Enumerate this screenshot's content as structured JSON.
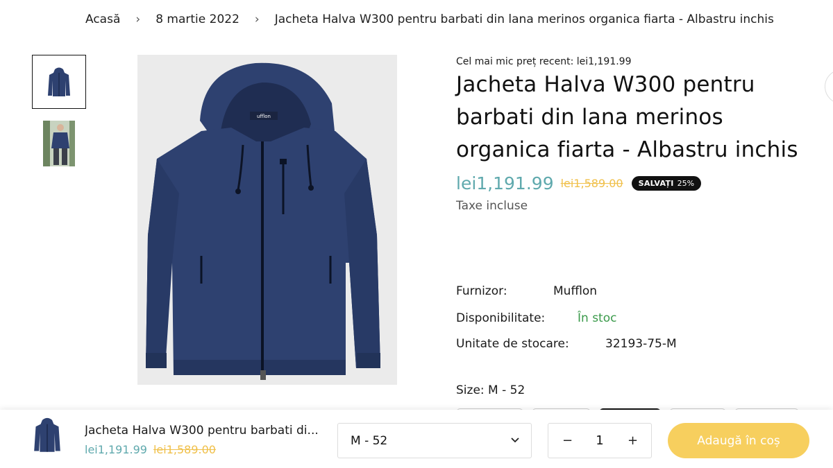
{
  "breadcrumb": {
    "items": [
      "Acasă",
      "8 martie 2022",
      "Jacheta Halva W300 pentru barbati din lana merinos organica fiarta - Albastru inchis"
    ],
    "separator": "›"
  },
  "product": {
    "lowest_price_label": "Cel mai mic preț recent: lei1,191.99",
    "title": "Jacheta Halva W300 pentru barbati din lana merinos organica fiarta - Albastru inchis",
    "price": "lei1,191.99",
    "compare_price": "lei1,589.00",
    "badge_label": "SALVAȚI",
    "badge_value": "25%",
    "tax_note": "Taxe incluse",
    "vendor_label": "Furnizor:",
    "vendor_value": "Mufflon",
    "availability_label": "Disponibilitate:",
    "availability_value": "În stoc",
    "sku_label": "Unitate de stocare:",
    "sku_value": "32193-75-M",
    "size_label": "Size: M - 52",
    "jacket_brand": "ufflon"
  },
  "sticky": {
    "title": "Jacheta Halva W300 pentru barbati di...",
    "price": "lei1,191.99",
    "compare_price": "lei1,589.00",
    "selected_variant": "M - 52",
    "quantity": "1",
    "minus": "−",
    "plus": "+",
    "add_to_cart": "Adaugă în coș"
  },
  "colors": {
    "price": "#5fa9ad",
    "compare": "#f0c04a",
    "stock": "#3a9a4a",
    "cta": "#f7cf5e",
    "jacket": "#2e4170"
  }
}
